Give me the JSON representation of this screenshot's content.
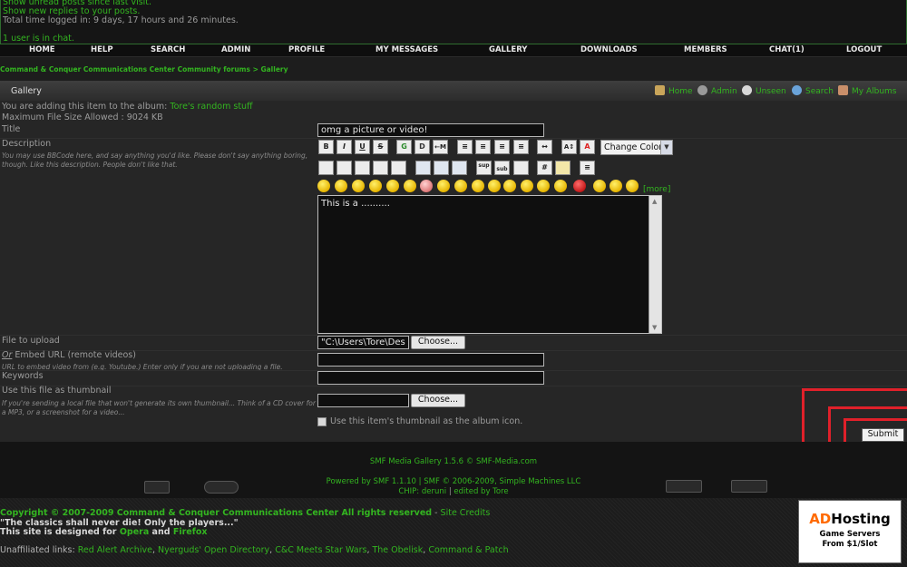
{
  "top_info": {
    "lines": [
      "Show unread posts since last visit.",
      "Show new replies to your posts.",
      "Total time logged in: 9 days, 17 hours and 26 minutes.",
      "1 user is in chat."
    ]
  },
  "menu": [
    "HOME",
    "HELP",
    "SEARCH",
    "ADMIN",
    "PROFILE",
    "MY MESSAGES",
    "GALLERY",
    "DOWNLOADS",
    "MEMBERS",
    "CHAT(1)",
    "LOGOUT"
  ],
  "breadcrumb": {
    "forum": "Command & Conquer Communications Center Community forums",
    "separator": " > ",
    "current": "Gallery"
  },
  "gallery_bar": {
    "title": "Gallery",
    "links": [
      "Home",
      "Admin",
      "Unseen",
      "Search",
      "My Albums"
    ]
  },
  "form": {
    "album_prefix": "You are adding this item to the album: ",
    "album_name": "Tore's random stuff",
    "max_size": "Maximum File Size Allowed : 9024 KB",
    "title_label": "Title",
    "title_value": "omg a picture or video!",
    "description_label": "Description",
    "description_hint": "You may use BBCode here, and say anything you'd like. Please don't say anything boring, though. Like this description. People don't like that.",
    "toolbar1": [
      "B",
      "I",
      "U",
      "S",
      "G",
      "D",
      "←M",
      "≡",
      "≡",
      "≡",
      "≡",
      "↔",
      "A↕",
      "A"
    ],
    "change_color": "Change Color",
    "toolbar2": [
      "",
      "",
      "",
      "",
      "",
      "",
      "",
      "",
      "sup",
      "sub",
      "",
      "#",
      "",
      "≡"
    ],
    "more_link": "[more]",
    "message": "This is a ..........",
    "file_label": "File to upload",
    "file_value": "\"C:\\Users\\Tore\\Des",
    "choose_label": "Choose...",
    "embed_or": "Or",
    "embed_label": " Embed URL (remote videos)",
    "embed_hint": "URL to embed video from (e.g. Youtube.) Enter only if you are not uploading a file.",
    "keywords_label": "Keywords",
    "thumb_label": "Use this file as thumbnail",
    "thumb_hint": "If you're sending a local file that won't generate its own thumbnail... Think of a CD cover for a MP3, or a screenshot for a video...",
    "album_icon_label": "Use this item's thumbnail as the album icon.",
    "submit_label": "Submit"
  },
  "footer": {
    "media": "SMF Media Gallery 1.5.6 © SMF-Media.com",
    "powered": "Powered by SMF 1.1.10 | SMF © 2006-2009, Simple Machines LLC",
    "chip_prefix": "CHIP: ",
    "chip_author": "deruni",
    "chip_sep": " | ",
    "edited": "edited by Tore"
  },
  "bottom": {
    "copyright": "Copyright © 2007-2009 Command & Conquer Communications Center All rights reserved",
    "site_credits": "Site Credits",
    "quote": "\"The classics shall never die! Only the players...\"",
    "designed_prefix": "This site is designed for ",
    "opera": "Opera",
    "and": " and ",
    "firefox": "Firefox",
    "unaffiliated": "Unaffiliated links:",
    "links": [
      "Red Alert Archive",
      "Nyerguds' Open Directory",
      "C&C Meets Star Wars",
      "The Obelisk",
      "Command & Patch"
    ]
  },
  "ad": {
    "ad": "AD",
    "hosting": "Hosting",
    "line1": "Game Servers",
    "line2": "From $1/Slot"
  },
  "colors": {
    "accent_green": "#33b520",
    "highlight_red": "#e0202a"
  }
}
